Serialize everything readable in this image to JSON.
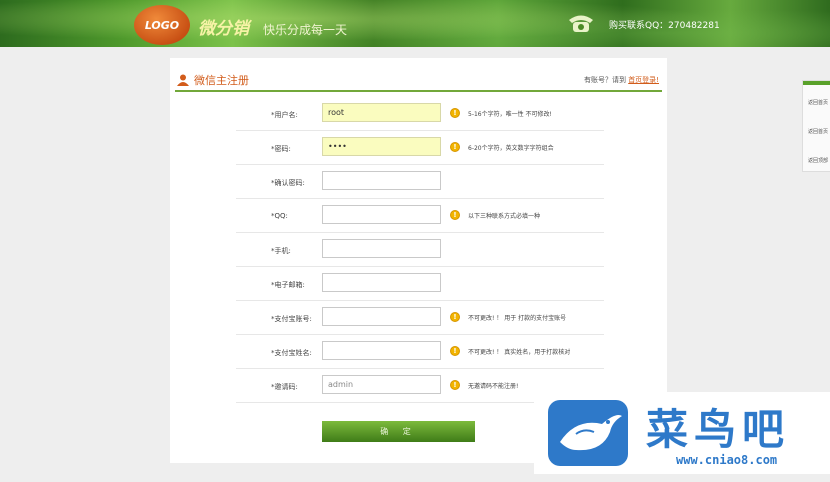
{
  "header": {
    "logo_text": "LOGO",
    "brand": "微分销",
    "slogan": "快乐分成每一天",
    "contact": "购买联系QQ：270482281"
  },
  "form": {
    "title": "微信主注册",
    "login_prompt": "有账号？请到",
    "login_link": "首页登录!",
    "submit_label": "确 定",
    "fields": [
      {
        "label": "*用户名:",
        "value": "root",
        "placeholder": "",
        "hint": "5-16个字符，唯一性 不可修改!"
      },
      {
        "label": "*密码:",
        "value": "••••",
        "placeholder": "",
        "hint": "6-20个字符，英文数字字符组合"
      },
      {
        "label": "*确认密码:",
        "value": "",
        "placeholder": "",
        "hint": ""
      },
      {
        "label": "*QQ:",
        "value": "",
        "placeholder": "",
        "hint": "以下三种联系方式必填一种"
      },
      {
        "label": "*手机:",
        "value": "",
        "placeholder": "",
        "hint": ""
      },
      {
        "label": "*电子邮箱:",
        "value": "",
        "placeholder": "",
        "hint": ""
      },
      {
        "label": "*支付宝账号:",
        "value": "",
        "placeholder": "",
        "hint": "不可更改! ！ 用于 打款的支付宝账号"
      },
      {
        "label": "*支付宝姓名:",
        "value": "",
        "placeholder": "",
        "hint": "不可更改! ！ 真实姓名，用于打款核对"
      },
      {
        "label": "*邀请码:",
        "value": "admin",
        "placeholder": "",
        "hint": "无邀请码不能注册!"
      }
    ]
  },
  "side_panel": {
    "items": [
      "返回首页",
      "返回首页",
      "返回顶部"
    ]
  },
  "watermark": {
    "cn": "菜鸟吧",
    "url": "www.cniao8.com"
  },
  "colors": {
    "accent_orange": "#d25c1b",
    "accent_green": "#72a83a",
    "input_filled": "#fafcbf"
  }
}
